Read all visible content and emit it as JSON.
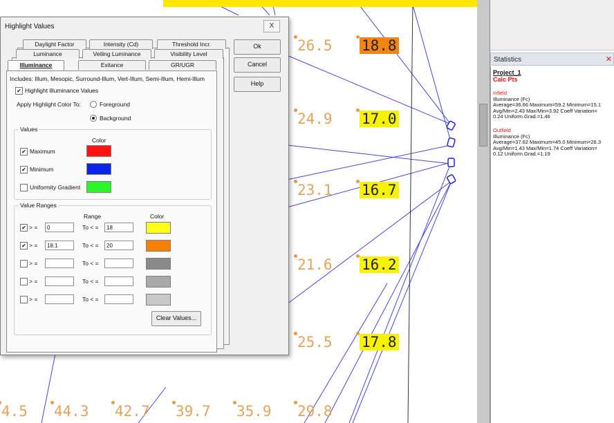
{
  "background_view": {
    "column_a": [
      "26.5",
      "24.9",
      "23.1",
      "21.6",
      "25.5"
    ],
    "column_b": [
      "18.8",
      "17.0",
      "16.7",
      "16.2",
      "17.8"
    ],
    "bottom_row": [
      "4.5",
      "44.3",
      "42.7",
      "39.7",
      "35.9",
      "29.8"
    ],
    "highlight_yellow": "#f7f300",
    "highlight_orange": "#f28512"
  },
  "statistics": {
    "title": "Statistics",
    "project": "Project_1",
    "calc_pts": "Calc Pts",
    "infield": {
      "name": "Infield",
      "lines": [
        "Illuminance (Fc)",
        "Average=36.66   Maximum=59.2   Minimum=15.1",
        "Avg/Min=2.43   Max/Min=3.92   Coeff Variation=",
        "0.24   Uniform.Grad.=1.46"
      ]
    },
    "outfield": {
      "name": "Outfield",
      "lines": [
        "Illuminance (Fc)",
        "Average=37.62   Maximum=45.0   Minimum=26.3",
        "Avg/Min=1.43   Max/Min=1.74   Coeff Variation=",
        "0.12   Uniform.Grad.=1.19"
      ]
    }
  },
  "dialog": {
    "title": "Highlight Values",
    "close": "X",
    "buttons": {
      "ok": "Ok",
      "cancel": "Cancel",
      "help": "Help"
    },
    "tabs_row1": [
      "Daylight Factor",
      "Intensity (Cd)",
      "Threshold Incr."
    ],
    "tabs_row2": [
      "Luminance",
      "Veiling Luminance",
      "Visibility Level"
    ],
    "tabs_row3": [
      "Illuminance",
      "Exitance",
      "GR/UGR"
    ],
    "includes": "Includes: Illum, Mesopic, Surround-Illum, Vert-Illum, Semi-Illum, Hemi-Illum",
    "highlight_checkbox": "Highlight Illuminance Values",
    "apply_label": "Apply Highlight Color To:",
    "radio_fg": "Foreground",
    "radio_bg": "Background",
    "values_group": "Values",
    "color_header": "Color",
    "values": [
      {
        "label": "Maximum",
        "checked": true,
        "color": "#ff1212"
      },
      {
        "label": "Minimum",
        "checked": true,
        "color": "#0c22e8"
      },
      {
        "label": "Uniformity Gradient",
        "checked": false,
        "color": "#2ef52a"
      }
    ],
    "ranges_group": "Value Ranges",
    "range_header": "Range",
    "ranges": [
      {
        "checked": true,
        "from": "0",
        "to": "18",
        "color": "#ffff1a"
      },
      {
        "checked": true,
        "from": "18.1",
        "to": "20",
        "color": "#f78000"
      },
      {
        "checked": false,
        "from": "",
        "to": "",
        "color": "#8a8a8a"
      },
      {
        "checked": false,
        "from": "",
        "to": "",
        "color": "#a9a9a9"
      },
      {
        "checked": false,
        "from": "",
        "to": "",
        "color": "#c8c8c8"
      }
    ],
    "range_from_label": "> =",
    "range_to_label": "To < =",
    "clear_button": "Clear Values..."
  }
}
